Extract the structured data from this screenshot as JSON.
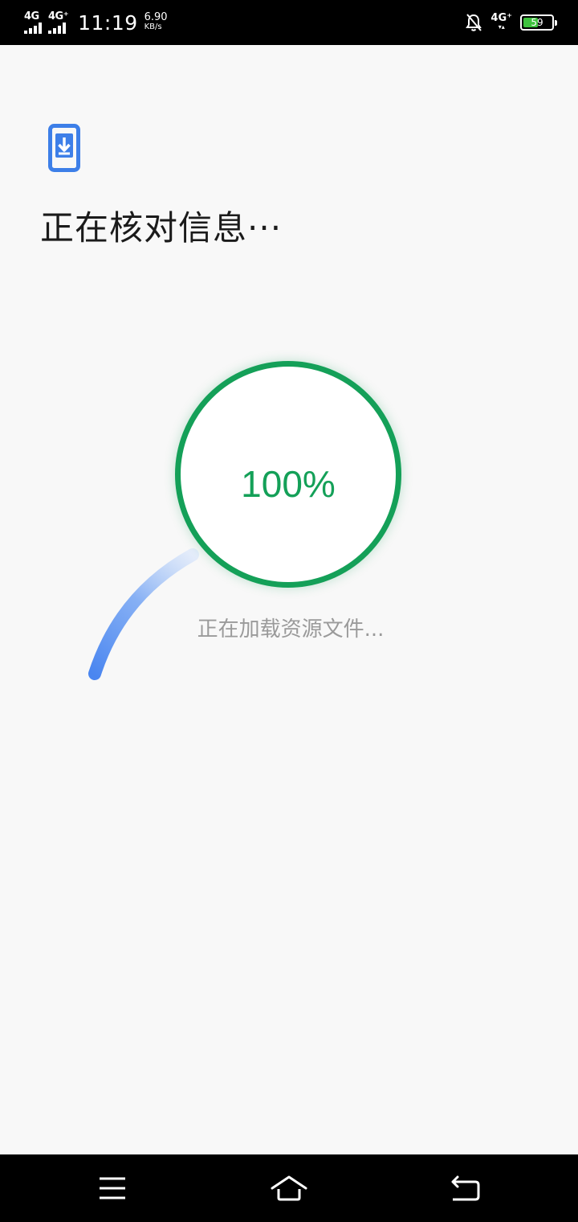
{
  "status_bar": {
    "sim1_label": "4G",
    "sim2_label": "4G⁺",
    "time": "11:19",
    "net_speed_value": "6.90",
    "net_speed_unit": "KB/s",
    "sim_right_label": "4G⁺",
    "sim_right_sub": "▾▴",
    "battery_level": "59",
    "battery_percent": 59,
    "battery_color": "#3ec23e",
    "icons": [
      "signal-icon",
      "signal-icon",
      "mute-bell-icon",
      "battery-icon"
    ]
  },
  "main": {
    "title": "正在核对信息···",
    "progress_text": "100%",
    "progress_value": 100,
    "status_text": "正在加载资源文件...",
    "accent_color": "#14a058",
    "spinner_color": "#4a86f0",
    "app_icon": "phone-download-icon"
  },
  "nav_bar": {
    "items": [
      "menu-icon",
      "home-icon",
      "back-icon"
    ]
  }
}
